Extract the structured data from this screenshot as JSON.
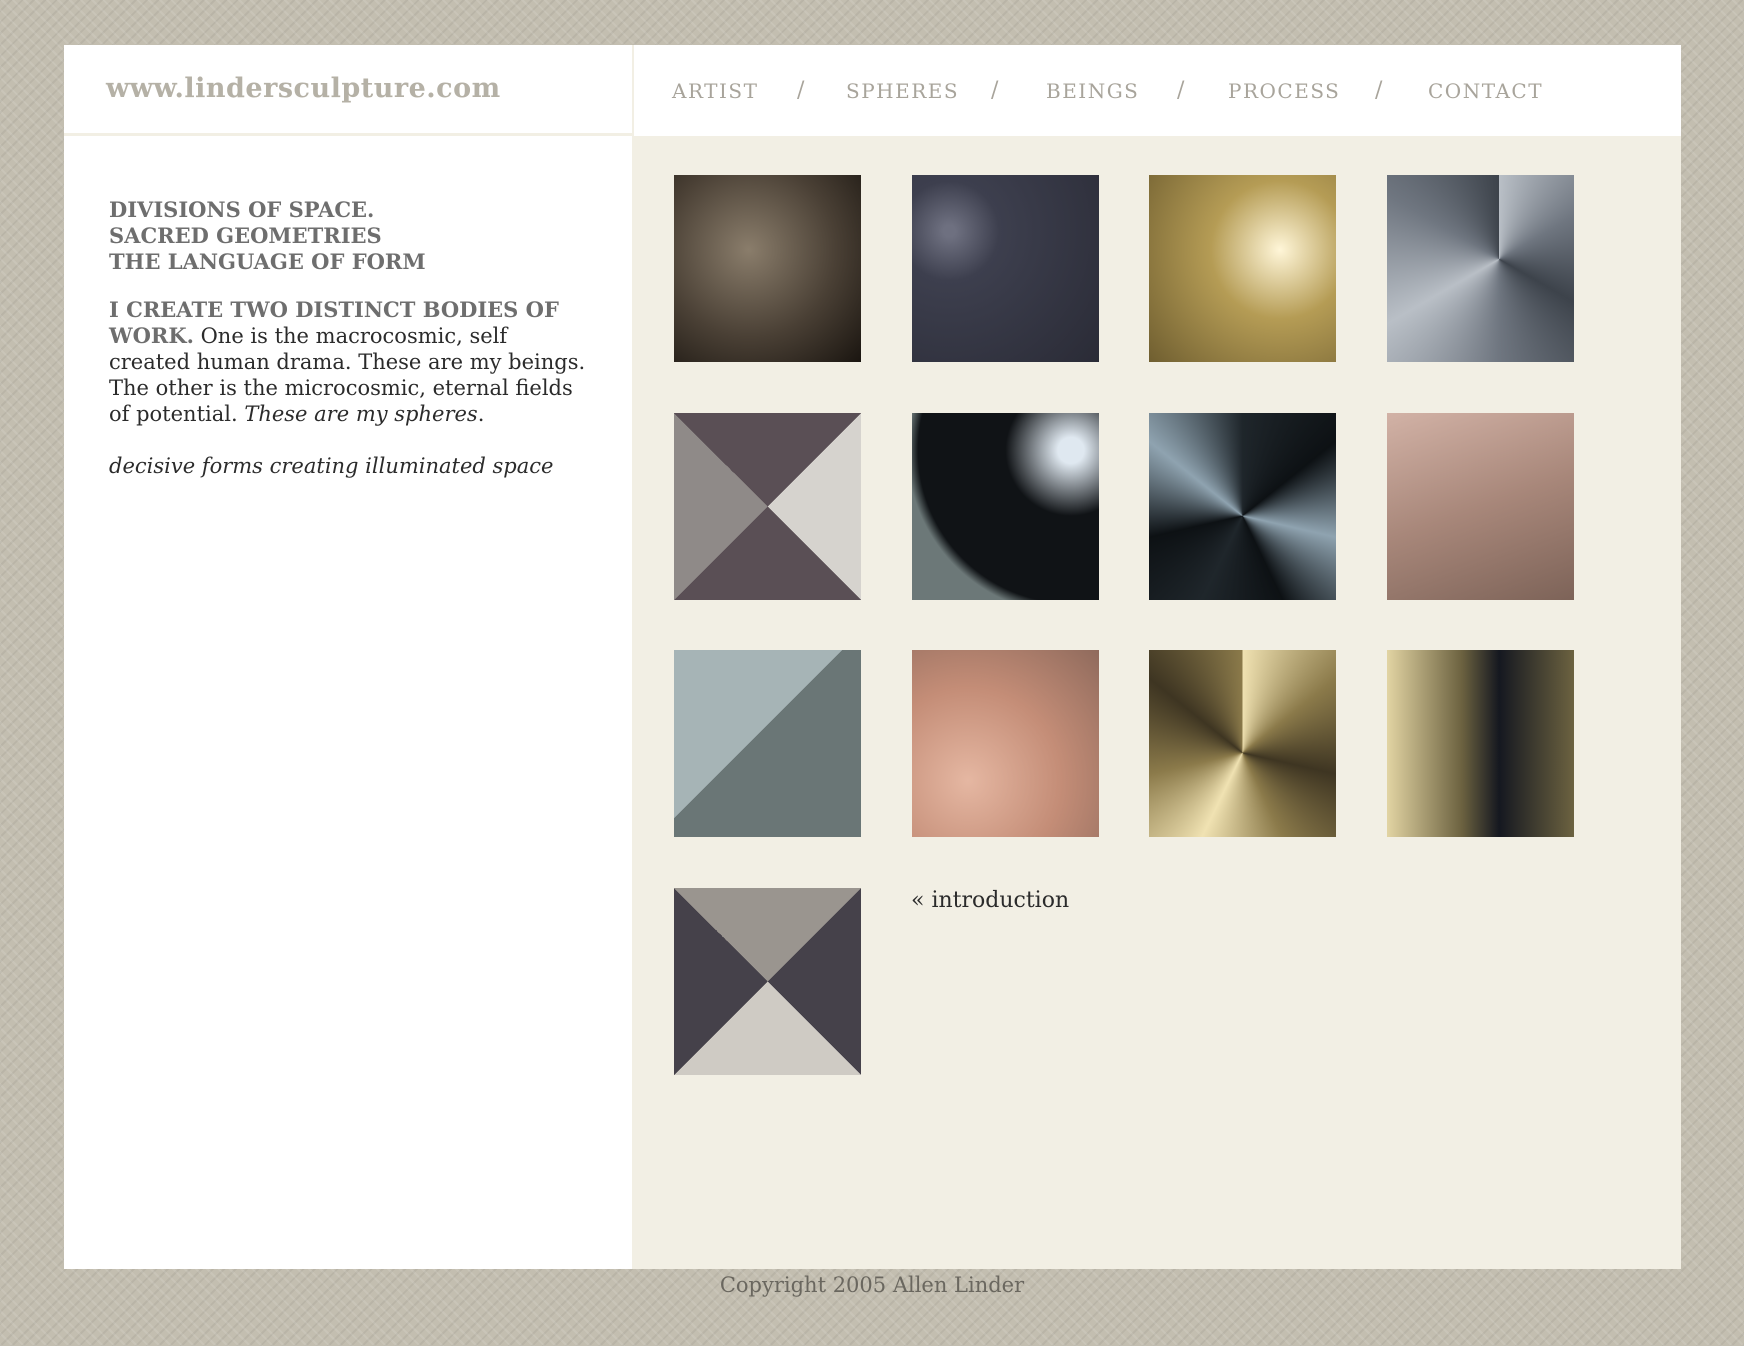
{
  "header": {
    "site_url": "www.lindersculpture.com"
  },
  "nav": {
    "items": [
      "ARTIST",
      "SPHERES",
      "BEINGS",
      "PROCESS",
      "CONTACT"
    ],
    "separator": "/"
  },
  "intro": {
    "headings": [
      "DIVISIONS OF SPACE.",
      "SACRED GEOMETRIES",
      "THE LANGUAGE OF FORM"
    ],
    "lead_bold": "I CREATE TWO DISTINCT BODIES OF WORK.",
    "body_text": " One is the macrocosmic, self created human drama. These are my beings. The other is the microcosmic, eternal fields of potential. ",
    "body_italic": "These are my spheres",
    "body_period": ".",
    "tagline": "decisive forms creating illuminated space"
  },
  "gallery": {
    "thumbnails": [
      {
        "name": "thumb-sandstone-sphere",
        "colors": [
          "#8a7d6b",
          "#4a4035",
          "#1a1510"
        ]
      },
      {
        "name": "thumb-dark-marble-glint",
        "colors": [
          "#6e7080",
          "#3d3f4e",
          "#2a2b36"
        ]
      },
      {
        "name": "thumb-bronze-glow",
        "colors": [
          "#fff6d8",
          "#b59c55",
          "#6f5e30"
        ]
      },
      {
        "name": "thumb-grey-star-facets",
        "colors": [
          "#b9bfc6",
          "#6f7680",
          "#3d434b"
        ]
      },
      {
        "name": "thumb-granite-pinwheel",
        "colors": [
          "#d6d3ce",
          "#5a4f55",
          "#8f8a88"
        ]
      },
      {
        "name": "thumb-black-orb",
        "colors": [
          "#dfe8f0",
          "#101316",
          "#6c7878"
        ]
      },
      {
        "name": "thumb-black-star-veins",
        "colors": [
          "#8fa3b0",
          "#1f262b",
          "#0d1114"
        ]
      },
      {
        "name": "thumb-pink-granite-facets",
        "colors": [
          "#d2b2a6",
          "#a8877a",
          "#7d6358"
        ]
      },
      {
        "name": "thumb-grey-stone-peak",
        "colors": [
          "#a6b4b6",
          "#6a7676",
          "#4b5554"
        ]
      },
      {
        "name": "thumb-pink-marble-curves",
        "colors": [
          "#e5b7a2",
          "#c48d77",
          "#8f6a5c"
        ]
      },
      {
        "name": "thumb-bronze-star",
        "colors": [
          "#f0e2b2",
          "#8b7a4a",
          "#3e3522"
        ]
      },
      {
        "name": "thumb-bronze-dark-curves",
        "colors": [
          "#e2d4a3",
          "#6c6240",
          "#151820"
        ]
      },
      {
        "name": "thumb-granite-diamond",
        "colors": [
          "#cfcbc4",
          "#45414a",
          "#9a958f"
        ]
      }
    ],
    "intro_link": "« introduction"
  },
  "footer": {
    "copyright": "Copyright 2005 Allen Linder"
  },
  "colors": {
    "page_bg": "#c3beb0",
    "panel_bg": "#f2efe4",
    "white": "#ffffff",
    "heading_grey": "#6e6e6e",
    "nav_grey": "#a8a49b",
    "text": "#2b2b2b"
  }
}
